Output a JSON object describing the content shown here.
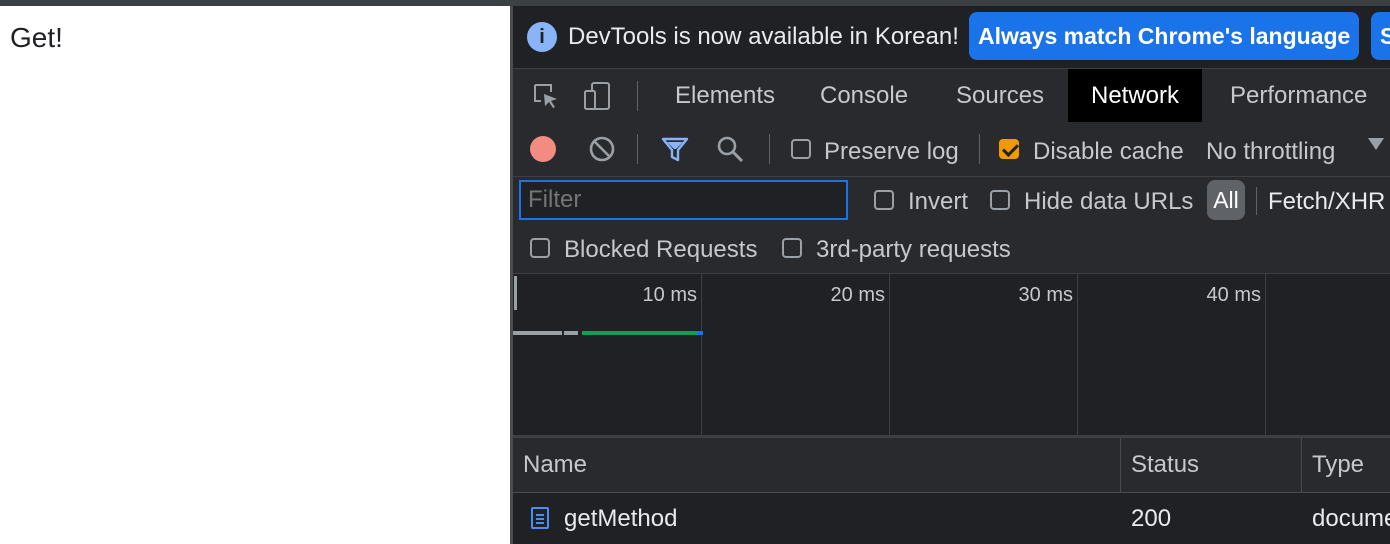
{
  "page": {
    "text": "Get!"
  },
  "infobar": {
    "message": "DevTools is now available in Korean!",
    "primary_button": "Always match Chrome's language",
    "secondary_button": "S"
  },
  "tabs": [
    {
      "label": "Elements",
      "active": false
    },
    {
      "label": "Console",
      "active": false
    },
    {
      "label": "Sources",
      "active": false
    },
    {
      "label": "Network",
      "active": true
    },
    {
      "label": "Performance",
      "active": false
    }
  ],
  "toolbar": {
    "preserve_log": {
      "label": "Preserve log",
      "checked": false
    },
    "disable_cache": {
      "label": "Disable cache",
      "checked": true
    },
    "throttling": "No throttling"
  },
  "filter": {
    "placeholder": "Filter",
    "value": "",
    "invert": {
      "label": "Invert",
      "checked": false
    },
    "hide_data_urls": {
      "label": "Hide data URLs",
      "checked": false
    },
    "type_all": "All",
    "type_fetch": "Fetch/XHR",
    "blocked_requests": {
      "label": "Blocked Requests",
      "checked": false
    },
    "third_party": {
      "label": "3rd-party requests",
      "checked": false
    }
  },
  "timeline": {
    "ticks": [
      "10 ms",
      "20 ms",
      "30 ms",
      "40 ms"
    ]
  },
  "table": {
    "columns": [
      "Name",
      "Status",
      "Type"
    ],
    "rows": [
      {
        "name": "getMethod",
        "status": "200",
        "type": "docume"
      }
    ]
  },
  "colors": {
    "accent": "#1a73e8",
    "record": "#f28b82",
    "checked": "#f29900",
    "waterfall_wait": "#9aa0a6",
    "waterfall_download": "#0f9d58",
    "waterfall_end": "#1a73e8"
  }
}
